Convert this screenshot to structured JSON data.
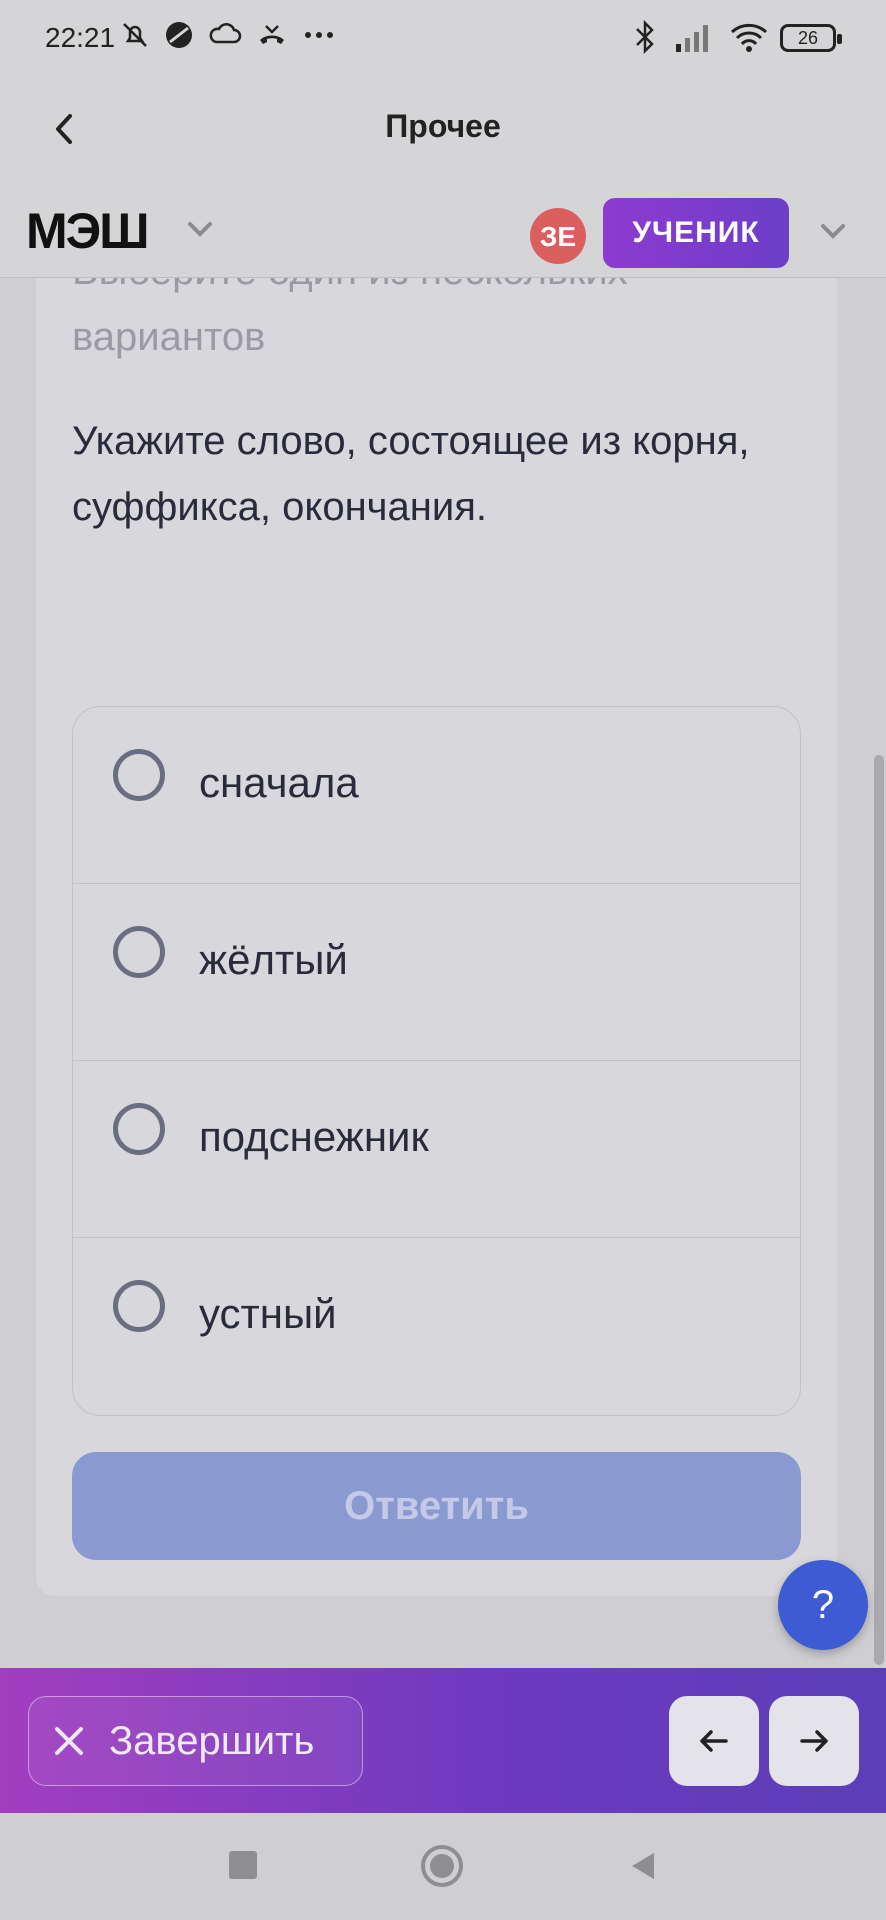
{
  "status_bar": {
    "time": "22:21",
    "battery": "26",
    "icons_left": [
      "bell-off-icon",
      "app-icon",
      "cloud-icon",
      "missed-call-icon",
      "more-dots-icon"
    ],
    "icons_right": [
      "bluetooth-icon",
      "signal-icon",
      "wifi-icon",
      "battery-icon"
    ]
  },
  "title_bar": {
    "title": "Прочее"
  },
  "header": {
    "logo": "МЭШ",
    "avatar_initials": "ЗЕ",
    "role": "УЧЕНИК",
    "colors": {
      "avatar": "#dc5f60",
      "role_badge": "#7a3ccc"
    }
  },
  "task": {
    "hint": "Выберите один из нескольких вариантов",
    "question": "Укажите слово, состоящее из корня, суффикса, окончания.",
    "options": [
      {
        "label": "сначала",
        "selected": false
      },
      {
        "label": "жёлтый",
        "selected": false
      },
      {
        "label": "подснежник",
        "selected": false
      },
      {
        "label": "устный",
        "selected": false
      }
    ],
    "answer_button": "Ответить"
  },
  "help_button": "?",
  "bottom_bar": {
    "finish_label": "Завершить",
    "prev_icon": "arrow-left-icon",
    "next_icon": "arrow-right-icon"
  },
  "colors": {
    "answer_button_bg": "#8a9ad0",
    "help_button_bg": "#3d5bd2",
    "bottom_bar_gradient": [
      "#a23ec0",
      "#5b3eb8"
    ]
  }
}
